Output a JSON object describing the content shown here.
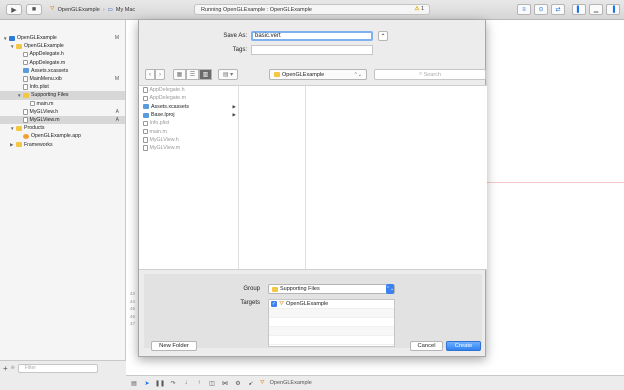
{
  "toolbar": {
    "scheme_target": "OpenGLExample",
    "scheme_device": "My Mac",
    "activity_text": "Running OpenGLExample : OpenGLExample",
    "warning_count": "1"
  },
  "navigator": {
    "items": [
      {
        "label": "OpenGLExample",
        "icon": "project-icon",
        "badge": "M",
        "indent": 0,
        "tri": "▼"
      },
      {
        "label": "OpenGLExample",
        "icon": "folder-icon",
        "badge": "",
        "indent": 1,
        "tri": "▼"
      },
      {
        "label": "AppDelegate.h",
        "icon": "file-icon",
        "badge": "",
        "indent": 2,
        "tri": ""
      },
      {
        "label": "AppDelegate.m",
        "icon": "file-icon",
        "badge": "",
        "indent": 2,
        "tri": ""
      },
      {
        "label": "Assets.xcassets",
        "icon": "assets-icon",
        "badge": "",
        "indent": 2,
        "tri": ""
      },
      {
        "label": "MainMenu.xib",
        "icon": "file-icon",
        "badge": "M",
        "indent": 2,
        "tri": ""
      },
      {
        "label": "Info.plist",
        "icon": "file-icon",
        "badge": "",
        "indent": 2,
        "tri": ""
      },
      {
        "label": "Supporting Files",
        "icon": "folder-icon",
        "badge": "",
        "indent": 2,
        "tri": "▼",
        "selected": true
      },
      {
        "label": "main.m",
        "icon": "file-icon",
        "badge": "",
        "indent": 3,
        "tri": ""
      },
      {
        "label": "MyGLView.h",
        "icon": "file-icon",
        "badge": "A",
        "indent": 2,
        "tri": ""
      },
      {
        "label": "MyGLView.m",
        "icon": "file-icon",
        "badge": "A",
        "indent": 2,
        "tri": "",
        "selected": true
      },
      {
        "label": "Products",
        "icon": "folder-icon",
        "badge": "",
        "indent": 1,
        "tri": "▼"
      },
      {
        "label": "OpenGLExample.app",
        "icon": "app-icon",
        "badge": "",
        "indent": 2,
        "tri": ""
      },
      {
        "label": "Frameworks",
        "icon": "folder-icon",
        "badge": "",
        "indent": 1,
        "tri": "▶"
      }
    ],
    "filter_placeholder": "Filter"
  },
  "editor": {
    "gutter_lines": [
      "43",
      "44",
      "45",
      "46",
      "47"
    ]
  },
  "bottombar": {
    "target_label": "OpenGLExample"
  },
  "save_sheet": {
    "save_as_label": "Save As:",
    "save_as_value": "basic.vert",
    "tags_label": "Tags:",
    "location": "OpenGLExample",
    "search_placeholder": "Search",
    "files": [
      {
        "name": "AppDelegate.h",
        "dir": false
      },
      {
        "name": "AppDelegate.m",
        "dir": false
      },
      {
        "name": "Assets.xcassets",
        "dir": true
      },
      {
        "name": "Base.lproj",
        "dir": true
      },
      {
        "name": "Info.plist",
        "dir": false
      },
      {
        "name": "main.m",
        "dir": false
      },
      {
        "name": "MyGLView.h",
        "dir": false
      },
      {
        "name": "MyGLView.m",
        "dir": false
      }
    ],
    "group_label": "Group",
    "group_value": "Supporting Files",
    "targets_label": "Targets",
    "targets": [
      {
        "name": "OpenGLExample",
        "checked": true
      }
    ],
    "new_folder_label": "New Folder",
    "cancel_label": "Cancel",
    "create_label": "Create"
  }
}
